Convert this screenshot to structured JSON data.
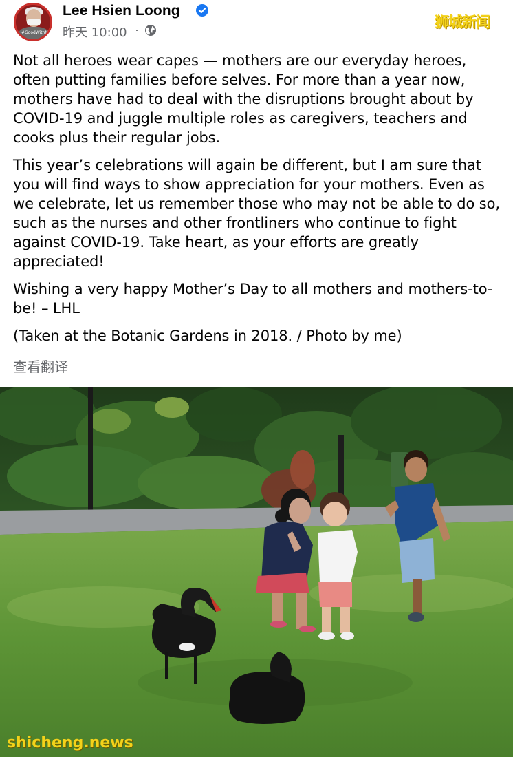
{
  "post": {
    "author": "Lee Hsien Loong",
    "avatar_caption": "#GoodWithMySelf",
    "time": "昨天 10:00",
    "time_separator": "·",
    "verified_icon": "verified-badge-icon",
    "audience_icon": "globe-icon",
    "paragraphs": [
      "Not all heroes wear capes — mothers are our everyday heroes, often putting families before selves. For more than a year now, mothers have had to deal with the disruptions brought about by COVID-19 and juggle multiple roles as caregivers, teachers and cooks plus their regular jobs.",
      "This year’s celebrations will again be different, but I am sure that you will find ways to show appreciation for your mothers. Even as we celebrate, let us remember those who may not be able to do so, such as the nurses and other frontliners who continue to fight against COVID-19. Take heart, as your efforts are greatly appreciated!",
      "Wishing a very happy Mother’s Day to all mothers and mothers-to-be! – LHL",
      "(Taken at the Botanic Gardens in 2018. / Photo by me)"
    ],
    "see_translation": "查看翻译"
  },
  "watermarks": {
    "top": "狮城新闻",
    "bottom": "shicheng.news"
  },
  "colors": {
    "text": "#050505",
    "secondary": "#65676b",
    "verified": "#1877f2",
    "watermark": "#f3d21a"
  }
}
